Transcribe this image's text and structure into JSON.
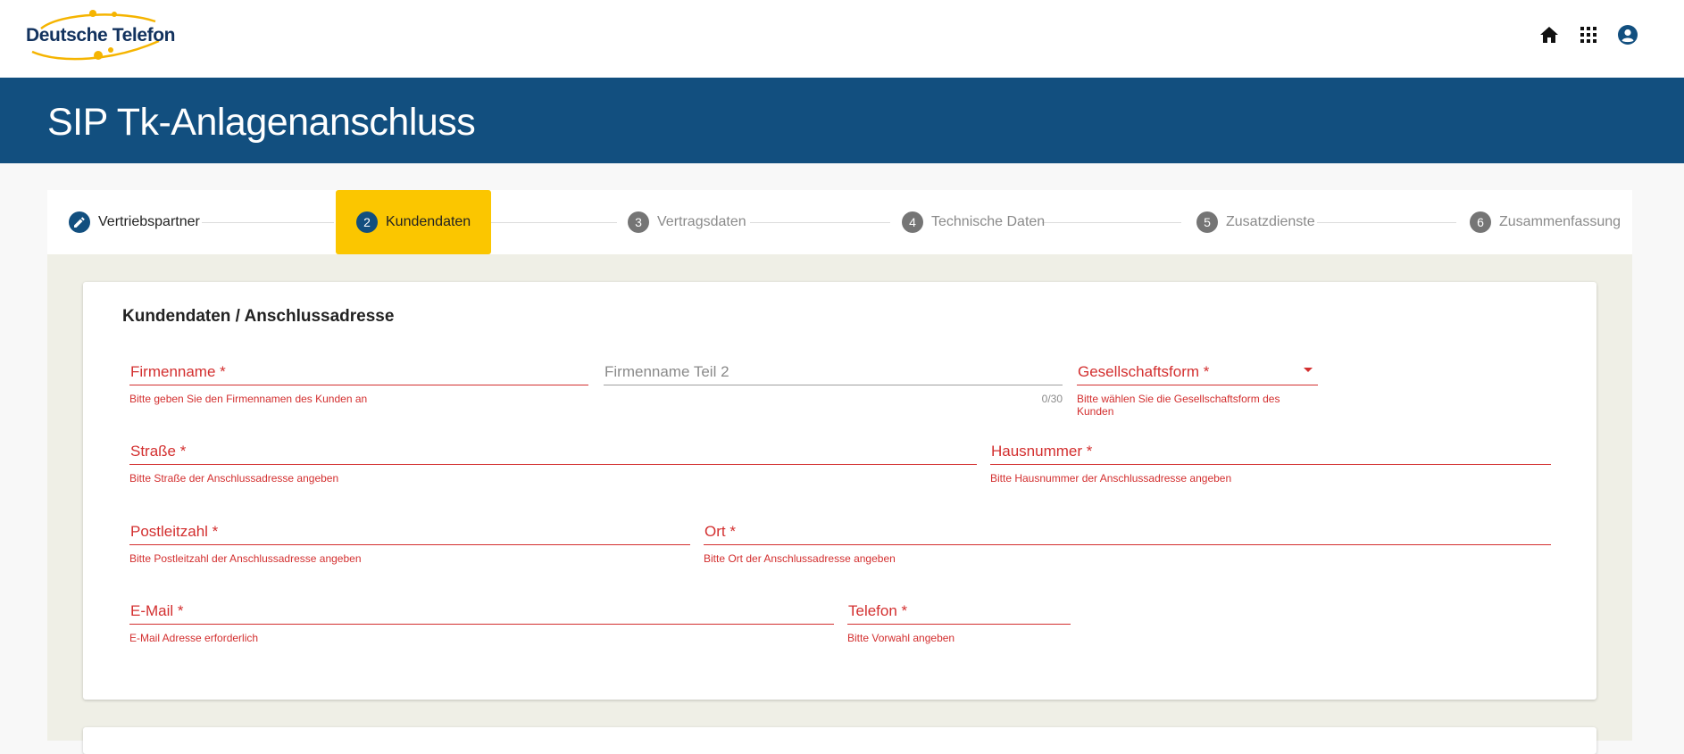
{
  "header": {
    "logo_text": "Deutsche Telefon",
    "icons": [
      "home-icon",
      "apps-grid-icon",
      "account-icon"
    ],
    "brand_color": "#12325e",
    "logo_accent_color": "#f5b400"
  },
  "banner": {
    "title": "SIP Tk-Anlagenanschluss",
    "color": "#124f7f"
  },
  "stepper": {
    "steps": [
      {
        "number": "",
        "label": "Vertriebspartner",
        "state": "done",
        "icon": "pencil-icon"
      },
      {
        "number": "2",
        "label": "Kundendaten",
        "state": "active"
      },
      {
        "number": "3",
        "label": "Vertragsdaten",
        "state": "pending"
      },
      {
        "number": "4",
        "label": "Technische Daten",
        "state": "pending"
      },
      {
        "number": "5",
        "label": "Zusatzdienste",
        "state": "pending"
      },
      {
        "number": "6",
        "label": "Zusammenfassung",
        "state": "pending"
      }
    ],
    "active_color": "#fbc600"
  },
  "form": {
    "title": "Kundendaten / Anschlussadresse",
    "error_color": "#d32f2f",
    "fields": {
      "firmenname": {
        "label": "Firmenname *",
        "hint": "Bitte geben Sie den Firmennamen des Kunden an",
        "value": ""
      },
      "firmenname2": {
        "label": "Firmenname Teil 2",
        "counter": "0/30",
        "value": ""
      },
      "gesellschaftsform": {
        "label": "Gesellschaftsform *",
        "hint": "Bitte wählen Sie die Gesellschaftsform des Kunden",
        "value": ""
      },
      "strasse": {
        "label": "Straße *",
        "hint": "Bitte Straße der Anschlussadresse angeben",
        "value": ""
      },
      "hausnummer": {
        "label": "Hausnummer *",
        "hint": "Bitte Hausnummer der Anschlussadresse angeben",
        "value": ""
      },
      "postleitzahl": {
        "label": "Postleitzahl *",
        "hint": "Bitte Postleitzahl der Anschlussadresse angeben",
        "value": ""
      },
      "ort": {
        "label": "Ort *",
        "hint": "Bitte Ort der Anschlussadresse angeben",
        "value": ""
      },
      "email": {
        "label": "E-Mail *",
        "hint": "E-Mail Adresse erforderlich",
        "value": ""
      },
      "telefon": {
        "label": "Telefon *",
        "hint": "Bitte Vorwahl angeben",
        "value": ""
      }
    }
  }
}
